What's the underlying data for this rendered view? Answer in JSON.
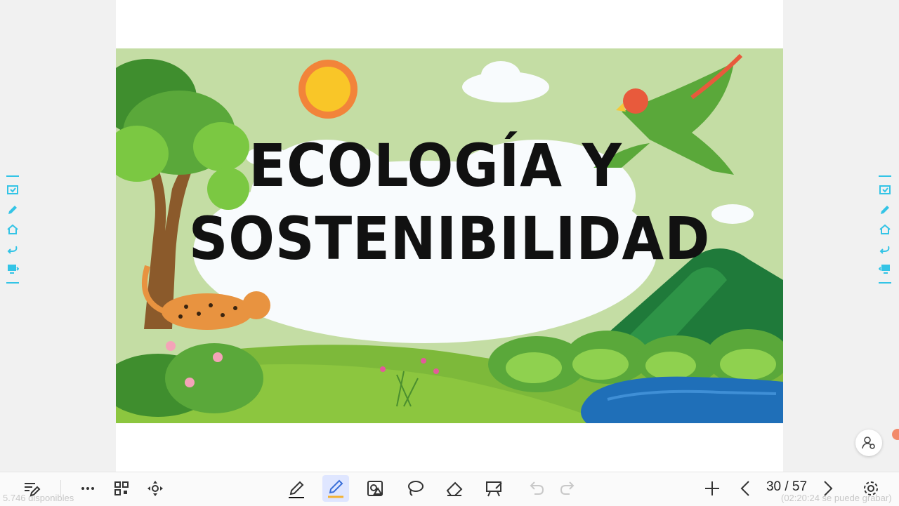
{
  "slide": {
    "title_line1": "ECOLOGÍA Y",
    "title_line2": "SOSTENIBILIDAD"
  },
  "side_menu": {
    "items": [
      "slides-icon",
      "pen-icon",
      "home-icon",
      "back-icon",
      "screen-icon"
    ]
  },
  "toolbar": {
    "page_counter": "30 / 57",
    "storage_text": "5.746 disponibles",
    "record_text": "(02:20:24 se puede grabar)"
  },
  "colors": {
    "accent": "#33c4e6",
    "active_tool": "#dfe6ff",
    "slide_bg": "#c4dda4",
    "grass": "#8cc63f",
    "water": "#1f6fb8"
  }
}
